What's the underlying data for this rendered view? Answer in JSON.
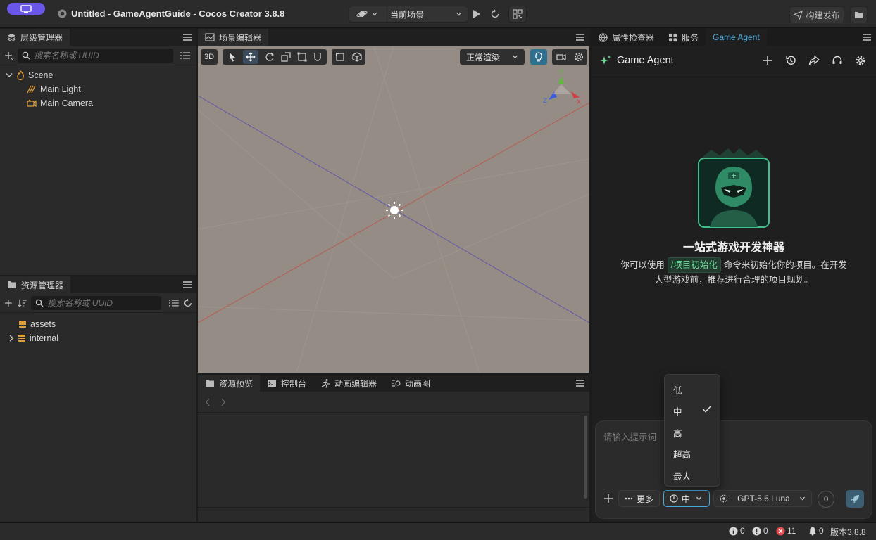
{
  "window": {
    "title": "Untitled - GameAgentGuide - Cocos Creator 3.8.8"
  },
  "toolbar": {
    "scene_select": "当前场景",
    "build_label": "构建发布"
  },
  "hierarchy": {
    "tab": "层级管理器",
    "search_placeholder": "搜索名称或 UUID",
    "root": "Scene",
    "children": [
      "Main Light",
      "Main Camera"
    ]
  },
  "assets": {
    "tab": "资源管理器",
    "search_placeholder": "搜索名称或 UUID",
    "items": [
      "assets",
      "internal"
    ]
  },
  "scene": {
    "tab": "场景编辑器",
    "mode_3d": "3D",
    "render_mode": "正常渲染",
    "gizmo_axes": {
      "x": "X",
      "y": "Y",
      "z": "Z"
    }
  },
  "bottom_tabs": [
    "资源预览",
    "控制台",
    "动画编辑器",
    "动画图"
  ],
  "right_tabs": [
    "属性检查器",
    "服务",
    "Game Agent"
  ],
  "agent": {
    "title": "Game Agent",
    "headline": "一站式游戏开发神器",
    "desc_prefix": "你可以使用",
    "command": "/项目初始化",
    "desc_suffix": "命令来初始化你的项目。在开发",
    "desc_line2": "大型游戏前，推荐进行合理的项目规划。",
    "input_placeholder": "请输入提示词",
    "more_label": "更多",
    "effort_value": "中",
    "model": "GPT-5.6 Luna",
    "counter": "0",
    "effort_options": [
      "低",
      "中",
      "高",
      "超高",
      "最大"
    ],
    "effort_selected": "中"
  },
  "status": {
    "info": "0",
    "warn": "0",
    "error": "11",
    "notify": "0",
    "version": "版本3.8.8"
  },
  "colors": {
    "accent": "#4aa8d8",
    "agent_badge": "#6a56e8",
    "command_green": "#6ddc9a",
    "error_red": "#e04b4b"
  }
}
